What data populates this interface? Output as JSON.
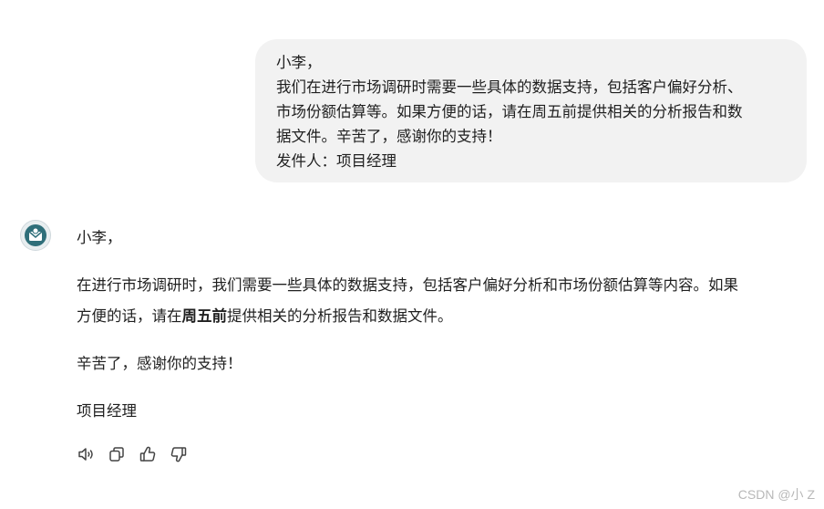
{
  "user_message": {
    "lines": [
      "小李，",
      "我们在进行市场调研时需要一些具体的数据支持，包括客户偏好分析、",
      "市场份额估算等。如果方便的话，请在周五前提供相关的分析报告和数",
      "据文件。辛苦了，感谢你的支持！",
      "发件人：项目经理"
    ]
  },
  "assistant_reply": {
    "greeting": "小李，",
    "para1_line1": "在进行市场调研时，我们需要一些具体的数据支持，包括客户偏好分析和市场份额估算等内容。如果",
    "para1_line2_before": "方便的话，请在",
    "para1_line2_bold": "周五前",
    "para1_line2_after": "提供相关的分析报告和数据文件。",
    "para2": "辛苦了，感谢你的支持！",
    "signature": "项目经理"
  },
  "actions": {
    "icons": [
      "speaker-icon",
      "copy-icon",
      "thumbs-up-icon",
      "thumbs-down-icon"
    ]
  },
  "watermark": "CSDN @小 Z",
  "colors": {
    "bubble_bg": "#f2f2f2",
    "text": "#1f1f1f",
    "icon": "#444444",
    "watermark": "#b8b8b8"
  }
}
